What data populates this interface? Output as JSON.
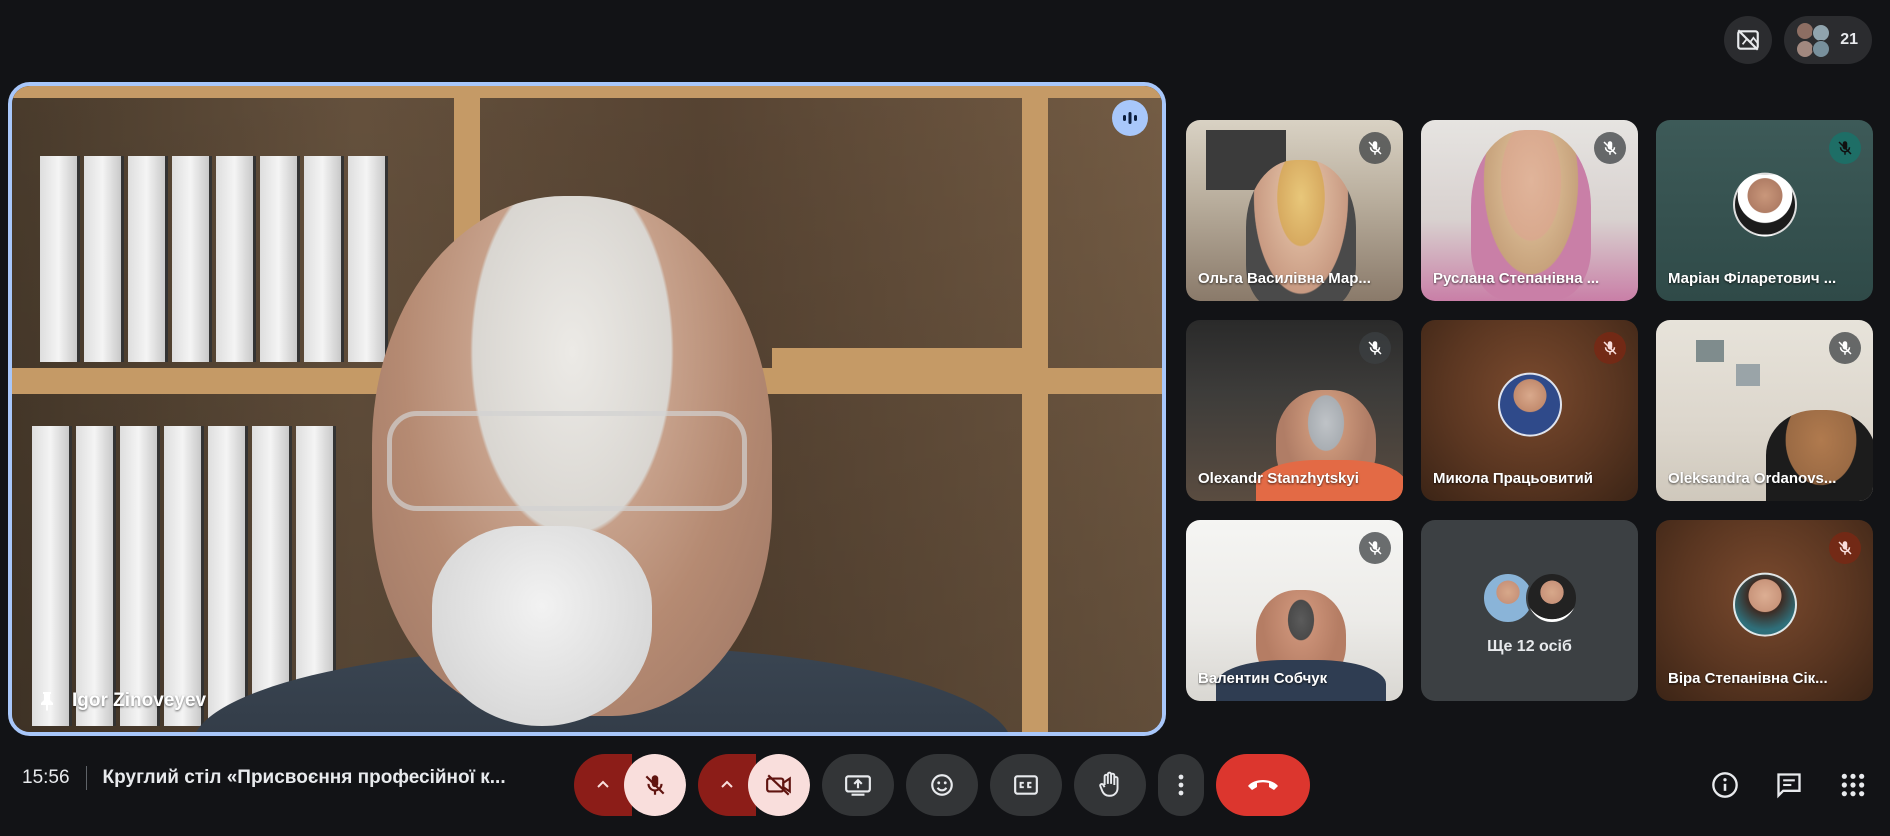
{
  "header": {
    "participant_count": "21"
  },
  "main_tile": {
    "name": "Igor Zinoveyev"
  },
  "tiles": [
    {
      "name": "Ольга Василівна Мар...",
      "mic": "off"
    },
    {
      "name": "Руслана Степанівна ...",
      "mic": "off"
    },
    {
      "name": "Маріан Філаретович ...",
      "mic": "off"
    },
    {
      "name": "Olexandr Stanzhytskyi",
      "mic": "off"
    },
    {
      "name": "Микола Працьовитий",
      "mic": "off"
    },
    {
      "name": "Oleksandra Ordanovs...",
      "mic": "off"
    },
    {
      "name": "Валентин Собчук",
      "mic": "off"
    },
    {
      "name": "Віра Степанівна Сік...",
      "mic": "off"
    }
  ],
  "more": {
    "label": "Ще 12 осіб"
  },
  "bottom": {
    "time": "15:56",
    "meeting_title": "Круглий стіл «Присвоєння професійної к..."
  },
  "colors": {
    "accent": "#a8c7fa",
    "end_call": "#dc362e",
    "muted_bg": "#8c1d18",
    "muted_fg": "#f9dedc"
  }
}
